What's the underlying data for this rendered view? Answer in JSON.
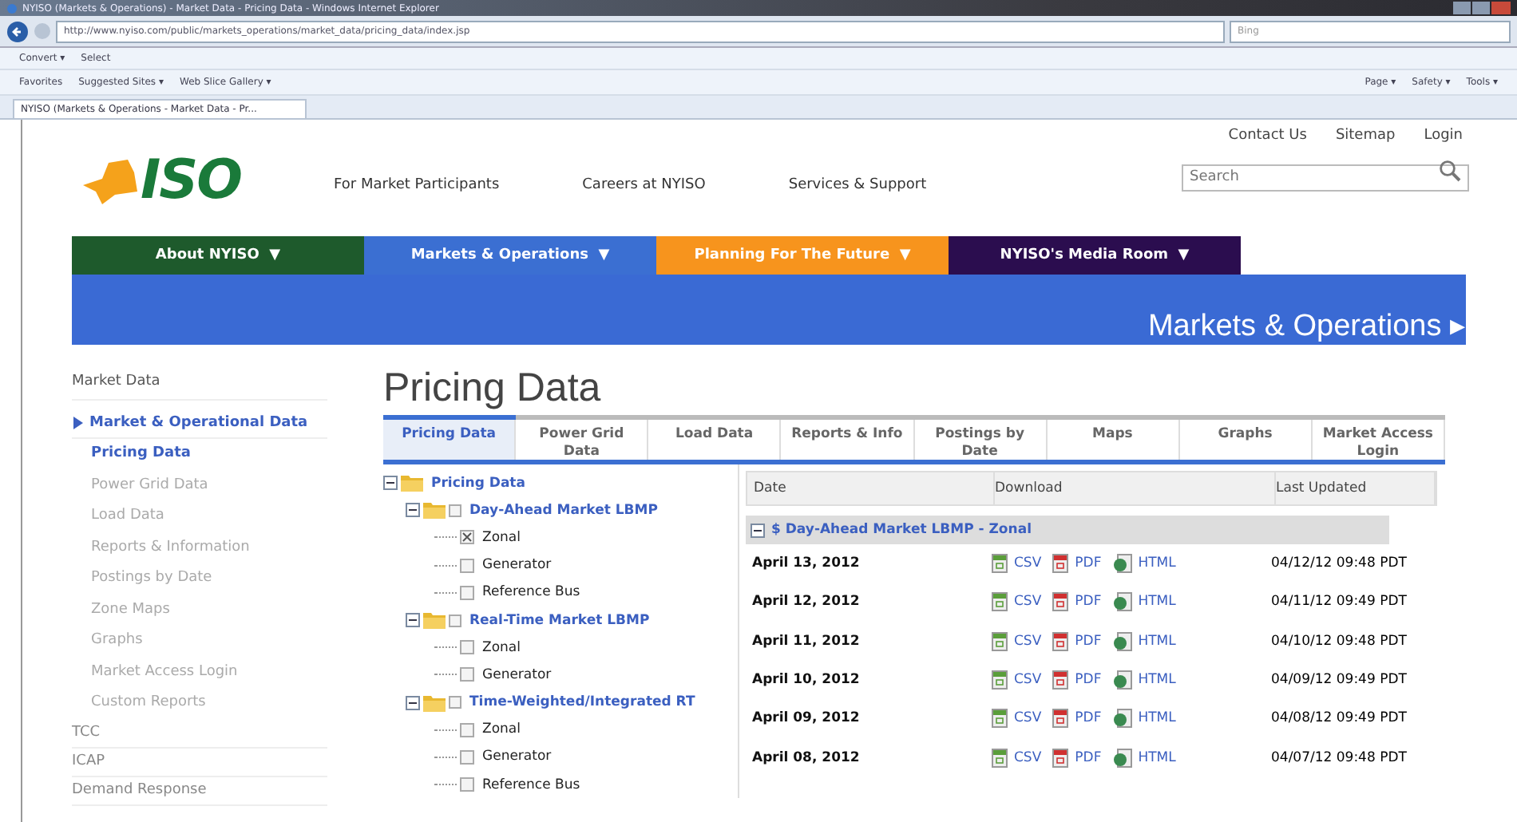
{
  "browser": {
    "title": "NYISO (Markets & Operations) - Market Data - Pricing Data - Windows Internet Explorer",
    "address": "http://www.nyiso.com/public/markets_operations/market_data/pricing_data/index.jsp",
    "search_placeholder": "Bing",
    "command_items": [
      "Convert ▾",
      "Select"
    ],
    "favorites": [
      "Favorites",
      "Suggested Sites ▾",
      "Web Slice Gallery ▾"
    ],
    "tab": "NYISO (Markets & Operations - Market Data - Pr...",
    "tools": [
      "Page ▾",
      "Safety ▾",
      "Tools ▾"
    ]
  },
  "header": {
    "logo": "ISO",
    "top_links": [
      "Contact Us",
      "Sitemap",
      "Login"
    ],
    "search": {
      "placeholder": "Search"
    },
    "links": [
      "For Market Participants",
      "Careers at NYISO",
      "Services & Support"
    ]
  },
  "nav": [
    {
      "label": "About NYISO",
      "arrow": "▼",
      "color": "#1e5a2c"
    },
    {
      "label": "Markets & Operations",
      "arrow": "▼",
      "color": "#3b6fd2"
    },
    {
      "label": "Planning For The Future",
      "arrow": "▼",
      "color": "#f7941d"
    },
    {
      "label": "NYISO's Media Room",
      "arrow": "▼",
      "color": "#2b0d4f"
    }
  ],
  "banner": "Markets & Operations ▸",
  "sidebar": {
    "heading": "Market Data",
    "items": [
      {
        "label": "Market & Operational Data",
        "selected": true,
        "expanded": true,
        "children": [
          {
            "label": "Pricing Data",
            "selected": true
          },
          {
            "label": "Power Grid Data",
            "selected": false
          },
          {
            "label": "Load Data",
            "selected": false
          },
          {
            "label": "Reports & Information",
            "selected": false
          },
          {
            "label": "Postings by Date",
            "selected": false
          },
          {
            "label": "Zone Maps",
            "selected": false
          },
          {
            "label": "Graphs",
            "selected": false
          },
          {
            "label": "Market Access Login",
            "selected": false
          },
          {
            "label": "Custom Reports",
            "selected": false
          }
        ]
      },
      {
        "label": "TCC",
        "selected": false,
        "expanded": false
      },
      {
        "label": "ICAP",
        "selected": false,
        "expanded": false
      },
      {
        "label": "Demand Response",
        "selected": false,
        "expanded": false
      }
    ]
  },
  "page_title": "Pricing Data",
  "tabs": [
    {
      "label": "Pricing Data",
      "selected": true
    },
    {
      "label": "Power Grid Data",
      "selected": false
    },
    {
      "label": "Load Data",
      "selected": false
    },
    {
      "label": "Reports & Info",
      "selected": false
    },
    {
      "label": "Postings by Date",
      "selected": false
    },
    {
      "label": "Maps",
      "selected": false
    },
    {
      "label": "Graphs",
      "selected": false
    },
    {
      "label": "Market Access Login",
      "selected": false
    }
  ],
  "tree": {
    "label": "Pricing Data",
    "expanded": true,
    "children": [
      {
        "label": "Day-Ahead Market LBMP",
        "expanded": true,
        "checked": false,
        "children": [
          {
            "label": "Zonal",
            "checked": true
          },
          {
            "label": "Generator",
            "checked": false
          },
          {
            "label": "Reference Bus",
            "checked": false
          }
        ]
      },
      {
        "label": "Real-Time Market LBMP",
        "expanded": true,
        "checked": false,
        "children": [
          {
            "label": "Zonal",
            "checked": false
          },
          {
            "label": "Generator",
            "checked": false
          }
        ]
      },
      {
        "label": "Time-Weighted/Integrated RT",
        "expanded": true,
        "checked": false,
        "children": [
          {
            "label": "Zonal",
            "checked": false
          },
          {
            "label": "Generator",
            "checked": false
          },
          {
            "label": "Reference Bus",
            "checked": false
          }
        ]
      }
    ]
  },
  "table": {
    "columns": [
      "Date",
      "Download",
      "Last Updated"
    ],
    "group": {
      "label": "$ Day-Ahead Market LBMP - Zonal",
      "expanded": true
    },
    "rows": [
      {
        "date": "April 13, 2012",
        "downloads": [
          {
            "kind": "csv",
            "label": "CSV"
          },
          {
            "kind": "pdf",
            "label": "PDF"
          },
          {
            "kind": "html",
            "label": "HTML"
          }
        ],
        "updated": "04/12/12 09:48 PDT"
      },
      {
        "date": "April 12, 2012",
        "downloads": [
          {
            "kind": "csv",
            "label": "CSV"
          },
          {
            "kind": "pdf",
            "label": "PDF"
          },
          {
            "kind": "html",
            "label": "HTML"
          }
        ],
        "updated": "04/11/12 09:49 PDT"
      },
      {
        "date": "April 11, 2012",
        "downloads": [
          {
            "kind": "csv",
            "label": "CSV"
          },
          {
            "kind": "pdf",
            "label": "PDF"
          },
          {
            "kind": "html",
            "label": "HTML"
          }
        ],
        "updated": "04/10/12 09:48 PDT"
      },
      {
        "date": "April 10, 2012",
        "downloads": [
          {
            "kind": "csv",
            "label": "CSV"
          },
          {
            "kind": "pdf",
            "label": "PDF"
          },
          {
            "kind": "html",
            "label": "HTML"
          }
        ],
        "updated": "04/09/12 09:49 PDT"
      },
      {
        "date": "April 09, 2012",
        "downloads": [
          {
            "kind": "csv",
            "label": "CSV"
          },
          {
            "kind": "pdf",
            "label": "PDF"
          },
          {
            "kind": "html",
            "label": "HTML"
          }
        ],
        "updated": "04/08/12 09:49 PDT"
      },
      {
        "date": "April 08, 2012",
        "downloads": [
          {
            "kind": "csv",
            "label": "CSV"
          },
          {
            "kind": "pdf",
            "label": "PDF"
          },
          {
            "kind": "html",
            "label": "HTML"
          }
        ],
        "updated": "04/07/12 09:48 PDT"
      }
    ]
  }
}
